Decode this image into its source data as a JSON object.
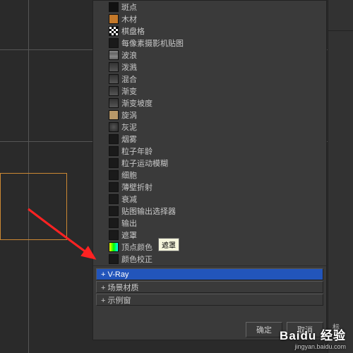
{
  "tree_items": [
    {
      "swatch": "sw-black",
      "label": "斑点"
    },
    {
      "swatch": "sw-orange",
      "label": "木材"
    },
    {
      "swatch": "sw-checker",
      "label": "棋盘格"
    },
    {
      "swatch": "sw-dark",
      "label": "每像素摄影机贴图"
    },
    {
      "swatch": "sw-wave",
      "label": "波浪"
    },
    {
      "swatch": "sw-grad",
      "label": "泼溅"
    },
    {
      "swatch": "sw-grad",
      "label": "混合"
    },
    {
      "swatch": "sw-grad",
      "label": "渐变"
    },
    {
      "swatch": "sw-grad",
      "label": "渐变坡度"
    },
    {
      "swatch": "sw-tan",
      "label": "旋涡"
    },
    {
      "swatch": "sw-noise",
      "label": "灰泥"
    },
    {
      "swatch": "sw-dark",
      "label": "烟雾"
    },
    {
      "swatch": "sw-dark",
      "label": "粒子年龄"
    },
    {
      "swatch": "sw-dark",
      "label": "粒子运动模糊"
    },
    {
      "swatch": "sw-dark",
      "label": "细胞"
    },
    {
      "swatch": "sw-dark",
      "label": "薄壁折射"
    },
    {
      "swatch": "sw-dark",
      "label": "衰减"
    },
    {
      "swatch": "sw-dark",
      "label": "贴图输出选择器"
    },
    {
      "swatch": "sw-dark",
      "label": "输出"
    },
    {
      "swatch": "sw-dark",
      "label": "遮罩"
    },
    {
      "swatch": "sw-rainbow",
      "label": "顶点颜色"
    },
    {
      "swatch": "sw-dark",
      "label": "颜色校正"
    }
  ],
  "tooltip": "遮罩",
  "categories": [
    {
      "label": "+ V-Ray",
      "selected": true
    },
    {
      "label": "+ 场景材质",
      "selected": false
    },
    {
      "label": "+ 示例窗",
      "selected": false
    }
  ],
  "buttons": {
    "ok": "确定",
    "cancel": "取消"
  },
  "watermark": {
    "main": "Baidu 经验",
    "sub": "jingyan.baidu.com"
  },
  "right": {
    "t1": "标"
  }
}
